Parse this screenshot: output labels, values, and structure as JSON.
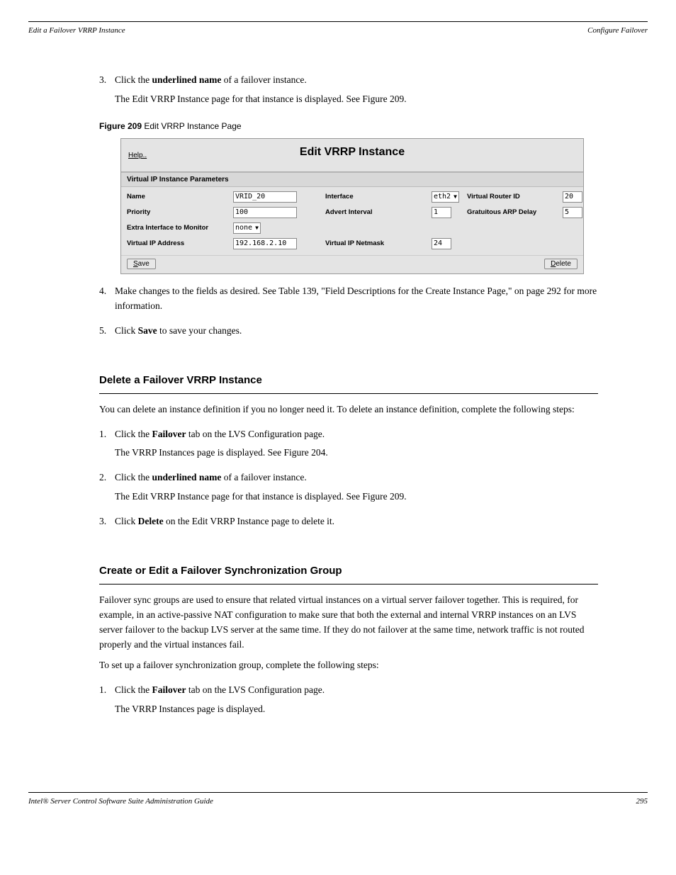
{
  "header": {
    "left": "Edit a Failover VRRP Instance",
    "right": "Configure Failover"
  },
  "steps": {
    "s3_num": "3.",
    "s3_text_a": "Click the ",
    "s3_text_b": "underlined name",
    "s3_text_c": " of a failover instance.",
    "s3_sub": "The Edit VRRP Instance page for that instance is displayed. See Figure 209.",
    "s4_num": "4.",
    "s4_text_a": "Make changes to the fields as desired. See ",
    "s4_text_b": "Table 139, \"Field Descriptions for the Create Instance Page,\" on page 292",
    "s4_text_c": " for more information.",
    "s5_num": "5.",
    "s5_text_a": "Click ",
    "s5_text_b": "Save",
    "s5_text_c": " to save your changes."
  },
  "figure": {
    "label": "Figure 209   ",
    "title": "Edit VRRP Instance Page"
  },
  "panel": {
    "help": "Help..",
    "title": "Edit VRRP Instance",
    "section": "Virtual IP Instance Parameters",
    "labels": {
      "name": "Name",
      "interface": "Interface",
      "vrid": "Virtual Router ID",
      "priority": "Priority",
      "advert": "Advert Interval",
      "arp": "Gratuitous ARP Delay",
      "extra": "Extra Interface to Monitor",
      "vip": "Virtual IP Address",
      "netmask": "Virtual IP Netmask"
    },
    "values": {
      "name": "VRID_20",
      "interface": "eth2",
      "vrid": "20",
      "priority": "100",
      "advert": "1",
      "arp": "5",
      "extra": "none",
      "vip": "192.168.2.10",
      "netmask": "24"
    },
    "buttons": {
      "save_u": "S",
      "save_r": "ave",
      "delete_u": "D",
      "delete_r": "elete"
    }
  },
  "sections": {
    "delete_title": "Delete a Failover VRRP Instance",
    "delete_para": "You can delete an instance definition if you no longer need it. To delete an instance definition, complete the following steps:",
    "d1_num": "1.",
    "d1_a": "Click the ",
    "d1_b": "Failover",
    "d1_c": " tab on the LVS Configuration page.",
    "d1_sub": "The VRRP Instances page is displayed. See Figure 204.",
    "d2_num": "2.",
    "d2_a": "Click the ",
    "d2_b": "underlined name",
    "d2_c": " of a failover instance.",
    "d2_sub": "The Edit VRRP Instance page for that instance is displayed. See Figure 209.",
    "d3_num": "3.",
    "d3_a": "Click ",
    "d3_b": "Delete",
    "d3_c": " on the Edit VRRP Instance page to delete it.",
    "sync_title": "Create or Edit a Failover Synchronization Group",
    "sync_para": "Failover sync groups are used to ensure that related virtual instances on a virtual server failover together. This is required, for example, in an active-passive NAT configuration to make sure that both the external and internal VRRP instances on an LVS server failover to the backup LVS server at the same time. If they do not failover at the same time, network traffic is not routed properly and the virtual instances fail.",
    "sync_para2": "To set up a failover synchronization group, complete the following steps:",
    "sg1_num": "1.",
    "sg1_a": "Click the ",
    "sg1_b": "Failover",
    "sg1_c": " tab on the LVS Configuration page.",
    "sg1_sub": "The VRRP Instances page is displayed."
  },
  "footer": {
    "left": "Intel® Server Control Software Suite Administration Guide",
    "right": "295"
  }
}
